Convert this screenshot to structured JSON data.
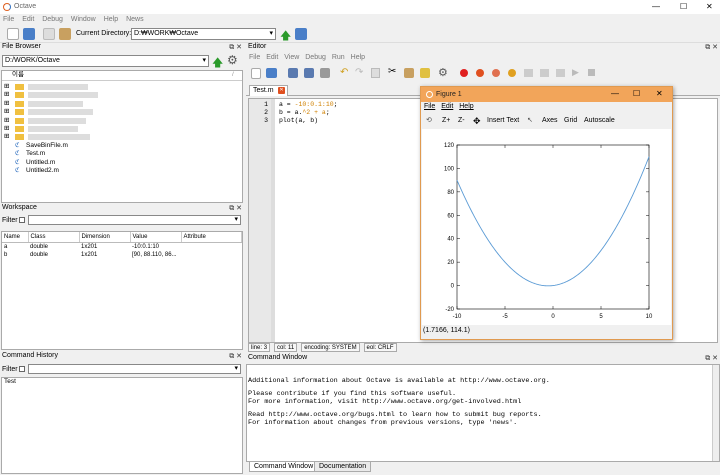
{
  "window": {
    "title": "Octave",
    "controls": [
      "—",
      "☐",
      "✕"
    ]
  },
  "menu": [
    "File",
    "Edit",
    "Debug",
    "Window",
    "Help",
    "News"
  ],
  "toolbar": {
    "current_dir_label": "Current Directory:",
    "current_dir_value": "D:₩WORK₩Octave"
  },
  "file_browser": {
    "title": "File Browser",
    "path": "D:/WORK/Octave",
    "column_header": "이름",
    "files": [
      "SaveBinFile.m",
      "Test.m",
      "Untitled.m",
      "Untitled2.m"
    ]
  },
  "workspace": {
    "title": "Workspace",
    "filter_label": "Filter",
    "columns": [
      "Name",
      "Class",
      "Dimension",
      "Value",
      "Attribute"
    ],
    "rows": [
      {
        "name": "a",
        "class": "double",
        "dimension": "1x201",
        "value": "-10:0.1:10",
        "attribute": ""
      },
      {
        "name": "b",
        "class": "double",
        "dimension": "1x201",
        "value": "[90, 88.110, 86...",
        "attribute": ""
      }
    ]
  },
  "command_history": {
    "title": "Command History",
    "filter_label": "Filter",
    "entries": [
      "Test"
    ]
  },
  "editor": {
    "title": "Editor",
    "menu": [
      "File",
      "Edit",
      "View",
      "Debug",
      "Run",
      "Help"
    ],
    "tab": "Test.m",
    "line_numbers": [
      "1",
      "2",
      "3"
    ],
    "lines": [
      {
        "p1": "a = ",
        "p2": "-10:0.1:10",
        "p3": ";"
      },
      {
        "p1": "b = a.",
        "p2": "^2 + a",
        "p3": ";"
      },
      {
        "p1": "plot(a, b)",
        "p2": "",
        "p3": ""
      }
    ],
    "status": {
      "line_label": "line:",
      "line": "3",
      "col_label": "col:",
      "col": "11",
      "encoding_label": "encoding:",
      "encoding": "SYSTEM",
      "eol_label": "eol:",
      "eol": "CRLF"
    }
  },
  "figure": {
    "title": "Figure 1",
    "menu": [
      "File",
      "Edit",
      "Help"
    ],
    "toolbar": [
      "Z+",
      "Z-",
      "Insert Text",
      "Axes",
      "Grid",
      "Autoscale"
    ],
    "coords": "(1.7166, 114.1)"
  },
  "chart_data": {
    "type": "line",
    "title": "",
    "xlabel": "",
    "ylabel": "",
    "xlim": [
      -10,
      10
    ],
    "ylim": [
      -20,
      120
    ],
    "xticks": [
      -10,
      -5,
      0,
      5,
      10
    ],
    "yticks": [
      -20,
      0,
      20,
      40,
      60,
      80,
      100,
      120
    ],
    "function": "y = x^2 + x",
    "x_range": {
      "start": -10,
      "end": 10,
      "step": 0.1
    },
    "line_color": "#5b9bd5",
    "grid": false
  },
  "command_window": {
    "title": "Command Window",
    "lines": [
      "",
      "Additional information about Octave is available at http://www.octave.org.",
      "",
      "Please contribute if you find this software useful.",
      "For more information, visit http://www.octave.org/get-involved.html",
      "",
      "Read http://www.octave.org/bugs.html to learn how to submit bug reports.",
      "For information about changes from previous versions, type 'news'."
    ],
    "tabs": [
      "Command Window",
      "Documentation"
    ]
  }
}
